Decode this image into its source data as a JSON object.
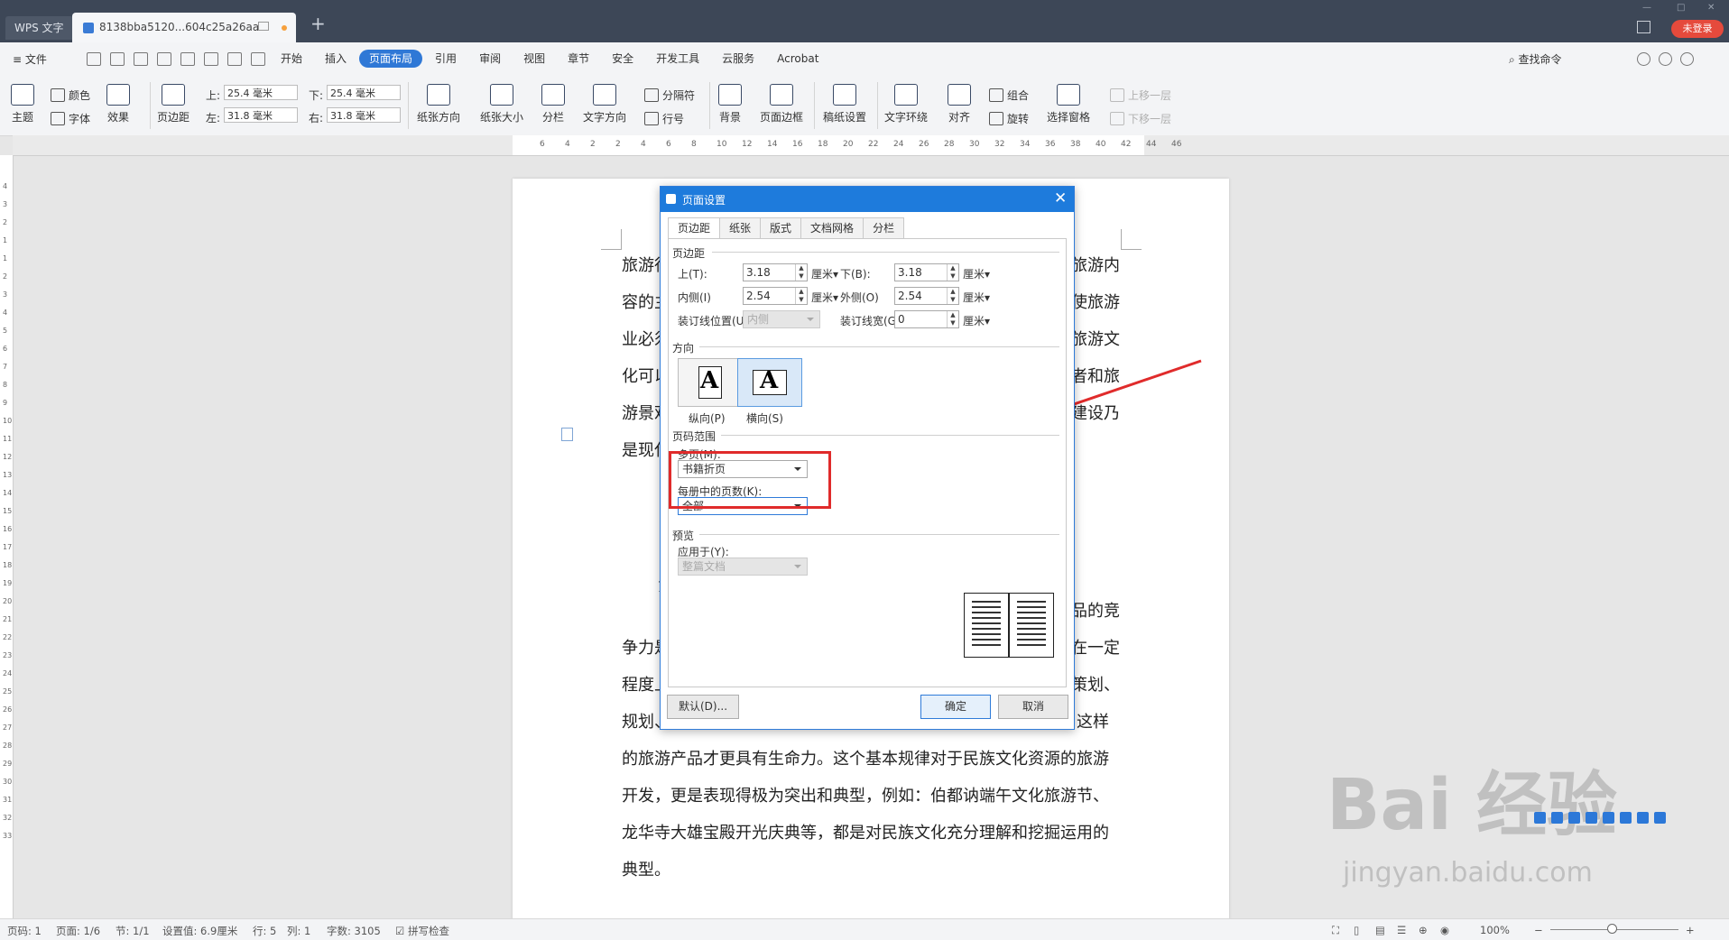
{
  "titlebar": {
    "app_tab": "WPS 文字",
    "doc_tab": "8138bba5120...604c25a26aa",
    "login": "未登录"
  },
  "menubar": {
    "file": "≡ 文件",
    "tabs": [
      "开始",
      "插入",
      "页面布局",
      "引用",
      "审阅",
      "视图",
      "章节",
      "安全",
      "开发工具",
      "云服务",
      "Acrobat"
    ],
    "active_tab": "页面布局",
    "find": "查找命令"
  },
  "ribbon": {
    "theme": "主题",
    "color": "颜色",
    "font": "字体",
    "effect": "效果",
    "margins": "页边距",
    "top_label": "上:",
    "top_value": "25.4 毫米",
    "bottom_label": "下:",
    "bottom_value": "25.4 毫米",
    "left_label": "左:",
    "left_value": "31.8 毫米",
    "right_label": "右:",
    "right_value": "31.8 毫米",
    "orientation": "纸张方向",
    "size": "纸张大小",
    "columns": "分栏",
    "text_direction": "文字方向",
    "separator": "分隔符",
    "line_number": "行号",
    "background": "背景",
    "page_border": "页面边框",
    "draft": "稿纸设置",
    "wrap": "文字环绕",
    "align": "对齐",
    "group": "组合",
    "rotate": "旋转",
    "select_pane": "选择窗格",
    "bring_forward": "上移一层",
    "send_backward": "下移一层"
  },
  "ruler": {
    "h_ticks": [
      "6",
      "4",
      "2",
      "2",
      "4",
      "6",
      "8",
      "10",
      "12",
      "14",
      "16",
      "18",
      "20",
      "22",
      "24",
      "26",
      "28",
      "30",
      "32",
      "34",
      "36",
      "38",
      "40",
      "42",
      "44",
      "46"
    ],
    "v_ticks": [
      "4",
      "3",
      "2",
      "1",
      "1",
      "2",
      "3",
      "4",
      "5",
      "6",
      "7",
      "8",
      "9",
      "10",
      "11",
      "12",
      "13",
      "14",
      "15",
      "16",
      "17",
      "18",
      "19",
      "20",
      "21",
      "22",
      "23",
      "24",
      "25",
      "26",
      "27",
      "28",
      "29",
      "30",
      "31",
      "32",
      "33"
    ]
  },
  "document": {
    "left_fragments": [
      "旅游行",
      "容的主",
      "业必须",
      "化可以",
      "游景观",
      "是现代"
    ],
    "right_fragments": [
      "旅游内",
      "使旅游",
      "旅游文",
      "者和旅",
      "建设乃"
    ],
    "heading_fragment": "1",
    "mid_left": [
      "争力是",
      "程度上"
    ],
    "mid_right": [
      "品的竞",
      "在一定",
      "策划、"
    ],
    "lines": [
      "规划、开发者对文化的理解。只有把旅游与文化紧密结合起来，这样",
      "的旅游产品才更具有生命力。这个基本规律对于民族文化资源的旅游",
      "开发，更是表现得极为突出和典型，例如：伯都讷端午文化旅游节、",
      "龙华寺大雄宝殿开光庆典等，都是对民族文化充分理解和挖掘运用的",
      "典型。"
    ]
  },
  "dialog": {
    "title": "页面设置",
    "tabs": [
      "页边距",
      "纸张",
      "版式",
      "文档网格",
      "分栏"
    ],
    "margins_section": "页边距",
    "top_label": "上(T):",
    "top_value": "3.18",
    "bottom_label": "下(B):",
    "bottom_value": "3.18",
    "inner_label": "内侧(I)",
    "inner_value": "2.54",
    "outer_label": "外侧(O)",
    "outer_value": "2.54",
    "gutter_pos_label": "装订线位置(U):",
    "gutter_pos_value": "内侧",
    "gutter_width_label": "装订线宽(G):",
    "gutter_width_value": "0",
    "unit": "厘米",
    "orientation_section": "方向",
    "portrait": "纵向(P)",
    "landscape": "横向(S)",
    "page_range_section": "页码范围",
    "multiple_label": "多页(M):",
    "multiple_value": "书籍折页",
    "per_booklet_label": "每册中的页数(K):",
    "per_booklet_value": "全部",
    "preview_section": "预览",
    "apply_label": "应用于(Y):",
    "apply_value": "整篇文档",
    "default_btn": "默认(D)...",
    "ok_btn": "确定",
    "cancel_btn": "取消",
    "orientation_glyph": "A"
  },
  "status": {
    "page_code": "页码: 1",
    "page": "页面: 1/6",
    "section": "节: 1/1",
    "setting": "设置值: 6.9厘米",
    "row": "行: 5",
    "col": "列: 1",
    "words": "字数: 3105",
    "spell": "拼写检查",
    "zoom": "100%"
  },
  "watermark": {
    "main": "Bai 经验",
    "url": "jingyan.baidu.com"
  }
}
